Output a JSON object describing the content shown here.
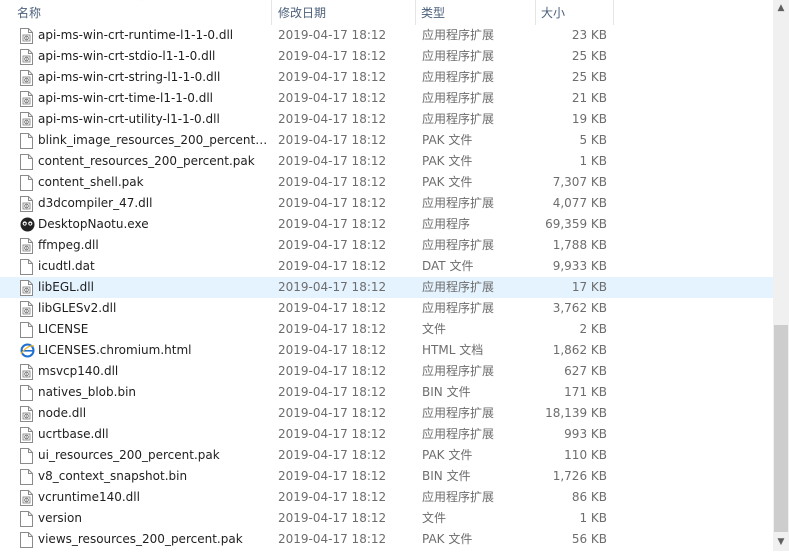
{
  "columns": {
    "name": "名称",
    "date": "修改日期",
    "type": "类型",
    "size": "大小"
  },
  "rows": [
    {
      "name": "api-ms-win-crt-runtime-l1-1-0.dll",
      "date": "2019-04-17 18:12",
      "type": "应用程序扩展",
      "size": "23 KB",
      "icon": "dll"
    },
    {
      "name": "api-ms-win-crt-stdio-l1-1-0.dll",
      "date": "2019-04-17 18:12",
      "type": "应用程序扩展",
      "size": "25 KB",
      "icon": "dll"
    },
    {
      "name": "api-ms-win-crt-string-l1-1-0.dll",
      "date": "2019-04-17 18:12",
      "type": "应用程序扩展",
      "size": "25 KB",
      "icon": "dll"
    },
    {
      "name": "api-ms-win-crt-time-l1-1-0.dll",
      "date": "2019-04-17 18:12",
      "type": "应用程序扩展",
      "size": "21 KB",
      "icon": "dll"
    },
    {
      "name": "api-ms-win-crt-utility-l1-1-0.dll",
      "date": "2019-04-17 18:12",
      "type": "应用程序扩展",
      "size": "19 KB",
      "icon": "dll"
    },
    {
      "name": "blink_image_resources_200_percent.p...",
      "date": "2019-04-17 18:12",
      "type": "PAK 文件",
      "size": "5 KB",
      "icon": "file"
    },
    {
      "name": "content_resources_200_percent.pak",
      "date": "2019-04-17 18:12",
      "type": "PAK 文件",
      "size": "1 KB",
      "icon": "file"
    },
    {
      "name": "content_shell.pak",
      "date": "2019-04-17 18:12",
      "type": "PAK 文件",
      "size": "7,307 KB",
      "icon": "file"
    },
    {
      "name": "d3dcompiler_47.dll",
      "date": "2019-04-17 18:12",
      "type": "应用程序扩展",
      "size": "4,077 KB",
      "icon": "dll"
    },
    {
      "name": "DesktopNaotu.exe",
      "date": "2019-04-17 18:12",
      "type": "应用程序",
      "size": "69,359 KB",
      "icon": "exe"
    },
    {
      "name": "ffmpeg.dll",
      "date": "2019-04-17 18:12",
      "type": "应用程序扩展",
      "size": "1,788 KB",
      "icon": "dll"
    },
    {
      "name": "icudtl.dat",
      "date": "2019-04-17 18:12",
      "type": "DAT 文件",
      "size": "9,933 KB",
      "icon": "file"
    },
    {
      "name": "libEGL.dll",
      "date": "2019-04-17 18:12",
      "type": "应用程序扩展",
      "size": "17 KB",
      "icon": "dll",
      "selected": true
    },
    {
      "name": "libGLESv2.dll",
      "date": "2019-04-17 18:12",
      "type": "应用程序扩展",
      "size": "3,762 KB",
      "icon": "dll"
    },
    {
      "name": "LICENSE",
      "date": "2019-04-17 18:12",
      "type": "文件",
      "size": "2 KB",
      "icon": "file"
    },
    {
      "name": "LICENSES.chromium.html",
      "date": "2019-04-17 18:12",
      "type": "HTML 文档",
      "size": "1,862 KB",
      "icon": "html"
    },
    {
      "name": "msvcp140.dll",
      "date": "2019-04-17 18:12",
      "type": "应用程序扩展",
      "size": "627 KB",
      "icon": "dll"
    },
    {
      "name": "natives_blob.bin",
      "date": "2019-04-17 18:12",
      "type": "BIN 文件",
      "size": "171 KB",
      "icon": "file"
    },
    {
      "name": "node.dll",
      "date": "2019-04-17 18:12",
      "type": "应用程序扩展",
      "size": "18,139 KB",
      "icon": "dll"
    },
    {
      "name": "ucrtbase.dll",
      "date": "2019-04-17 18:12",
      "type": "应用程序扩展",
      "size": "993 KB",
      "icon": "dll"
    },
    {
      "name": "ui_resources_200_percent.pak",
      "date": "2019-04-17 18:12",
      "type": "PAK 文件",
      "size": "110 KB",
      "icon": "file"
    },
    {
      "name": "v8_context_snapshot.bin",
      "date": "2019-04-17 18:12",
      "type": "BIN 文件",
      "size": "1,726 KB",
      "icon": "file"
    },
    {
      "name": "vcruntime140.dll",
      "date": "2019-04-17 18:12",
      "type": "应用程序扩展",
      "size": "86 KB",
      "icon": "dll"
    },
    {
      "name": "version",
      "date": "2019-04-17 18:12",
      "type": "文件",
      "size": "1 KB",
      "icon": "file"
    },
    {
      "name": "views_resources_200_percent.pak",
      "date": "2019-04-17 18:12",
      "type": "PAK 文件",
      "size": "56 KB",
      "icon": "file"
    }
  ],
  "colors": {
    "selected_row": "#e5f3ff",
    "header_text": "#4c607a",
    "meta_text": "#6d6d6d"
  }
}
